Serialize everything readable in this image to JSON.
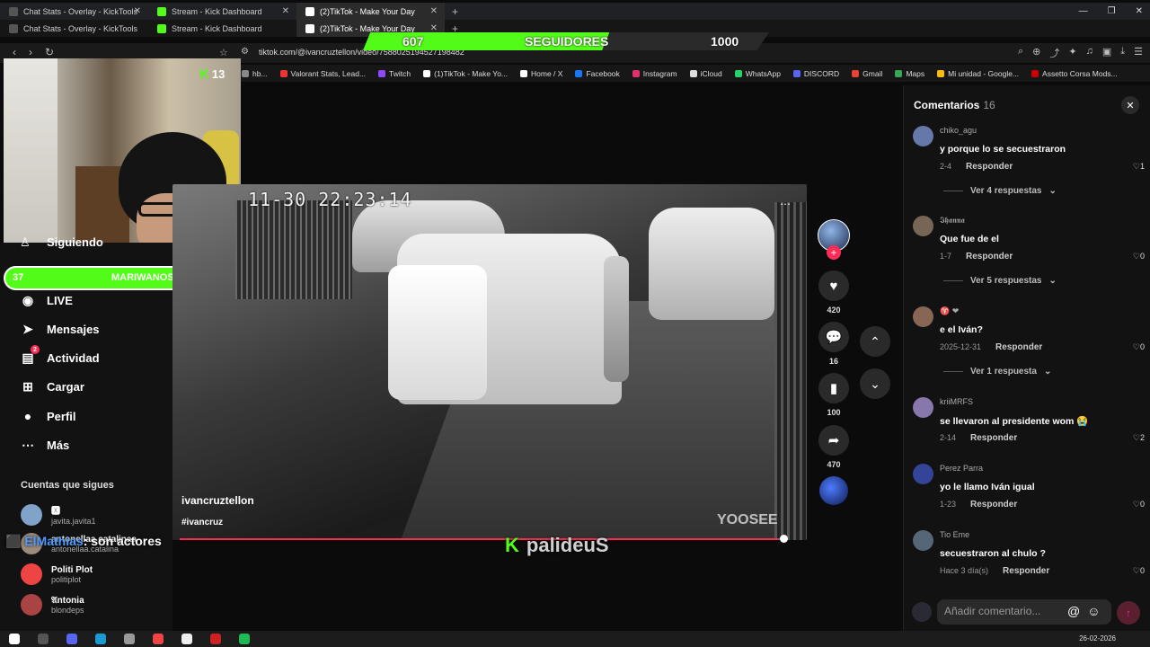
{
  "tabs_row1": [
    {
      "title": "Chat Stats - Overlay - KickTools",
      "color": "#555"
    },
    {
      "title": "Stream - Kick Dashboard",
      "color": "#53fc18"
    },
    {
      "title": "(2)TikTok - Make Your Day",
      "color": "#fff",
      "active": true
    }
  ],
  "tabs_row2": [
    {
      "title": "Chat Stats - Overlay - KickTools",
      "color": "#555"
    },
    {
      "title": "Stream - Kick Dashboard",
      "color": "#53fc18"
    },
    {
      "title": "(2)TikTok - Make Your Day",
      "color": "#fff",
      "active": true
    }
  ],
  "url": "tiktok.com/@ivancruztellon/video/7588025194527198482",
  "bookmarks": [
    {
      "label": "hb...",
      "color": "#888"
    },
    {
      "label": "Valorant Stats, Lead...",
      "color": "#e33"
    },
    {
      "label": "Twitch",
      "color": "#9147ff"
    },
    {
      "label": "(1)TikTok - Make Yo...",
      "color": "#fff"
    },
    {
      "label": "Home / X",
      "color": "#fff"
    },
    {
      "label": "Facebook",
      "color": "#1877f2"
    },
    {
      "label": "Instagram",
      "color": "#e1306c"
    },
    {
      "label": "iCloud",
      "color": "#ddd"
    },
    {
      "label": "WhatsApp",
      "color": "#25d366"
    },
    {
      "label": "DISCORD",
      "color": "#5865f2"
    },
    {
      "label": "Gmail",
      "color": "#ea4335"
    },
    {
      "label": "Maps",
      "color": "#34a853"
    },
    {
      "label": "Mi unidad - Google...",
      "color": "#fbbc05"
    },
    {
      "label": "Assetto Corsa Mods...",
      "color": "#c00"
    }
  ],
  "followers_goal": {
    "current": "607",
    "label": "SEGUIDORES",
    "target": "1000",
    "progress": 0.607
  },
  "kick_badge": {
    "letter": "K",
    "count": "13"
  },
  "mariwanos_goal": {
    "current": "37",
    "label": "MARIWANOS",
    "target": "50",
    "progress": 0.74
  },
  "sidebar": {
    "following_label": "Siguiendo",
    "items": [
      {
        "label": "LIVE",
        "icon": "live-icon"
      },
      {
        "label": "Mensajes",
        "icon": "send-icon"
      },
      {
        "label": "Actividad",
        "icon": "inbox-icon",
        "badge": "2"
      },
      {
        "label": "Cargar",
        "icon": "plus-square-icon"
      },
      {
        "label": "Perfil",
        "icon": "avatar-icon"
      },
      {
        "label": "Más",
        "icon": "more-icon"
      }
    ],
    "accounts_title": "Cuentas que sigues",
    "accounts": [
      {
        "name": "🆇",
        "handle": "javita.javita1",
        "color": "#7fa3c9"
      },
      {
        "name": "antonellaa catalinaa",
        "handle": "antonellaa.catalina",
        "color": "#9c8a7a"
      },
      {
        "name": "Politi Plot",
        "handle": "politiplot",
        "color": "#e44"
      },
      {
        "name": "𝔄ntonia",
        "handle": "blondeps",
        "color": "#a44"
      }
    ]
  },
  "chat_overlay": {
    "user": "ElMathias",
    "message": ": son actores"
  },
  "video": {
    "timestamp": "11-30  22:23:14",
    "author": "ivancruztellon",
    "hashtag": "#ivancruz",
    "watermark": "YOOSEE",
    "progress": 0.99
  },
  "streamer_watermark": "palideuS",
  "actions": {
    "likes": "420",
    "comments": "16",
    "saves": "100",
    "shares": "470"
  },
  "comments_panel": {
    "title": "Comentarios",
    "count": "16",
    "reply_label": "Responder",
    "input_placeholder": "Añadir comentario...",
    "comments": [
      {
        "user": "chiko_agu",
        "text": "y porque lo se secuestraron",
        "date": "2-4",
        "likes": "1",
        "replies": "Ver 4 respuestas",
        "color": "#6677aa"
      },
      {
        "user": "𝕴𝖍𝖆𝖓𝖓𝖆",
        "text": "Que fue de el",
        "date": "1-7",
        "likes": "0",
        "replies": "Ver 5 respuestas",
        "color": "#776655"
      },
      {
        "user": "♈ ❤",
        "text": "e el Iván?",
        "date": "2025-12-31",
        "likes": "0",
        "replies": "Ver 1 respuesta",
        "color": "#886655"
      },
      {
        "user": "kriiMRFS",
        "text": "se llevaron al presidente wom 😭",
        "date": "2-14",
        "likes": "2",
        "replies": "",
        "color": "#8877aa"
      },
      {
        "user": "Perez Parra",
        "text": "yo le llamo Iván igual",
        "date": "1-23",
        "likes": "0",
        "replies": "",
        "color": "#334499"
      },
      {
        "user": "Tio Eme",
        "text": "secuestraron al chulo ?",
        "date": "Hace 3 día(s)",
        "likes": "0",
        "replies": "",
        "color": "#556677"
      }
    ]
  },
  "clock": {
    "date": "26-02-2026"
  }
}
